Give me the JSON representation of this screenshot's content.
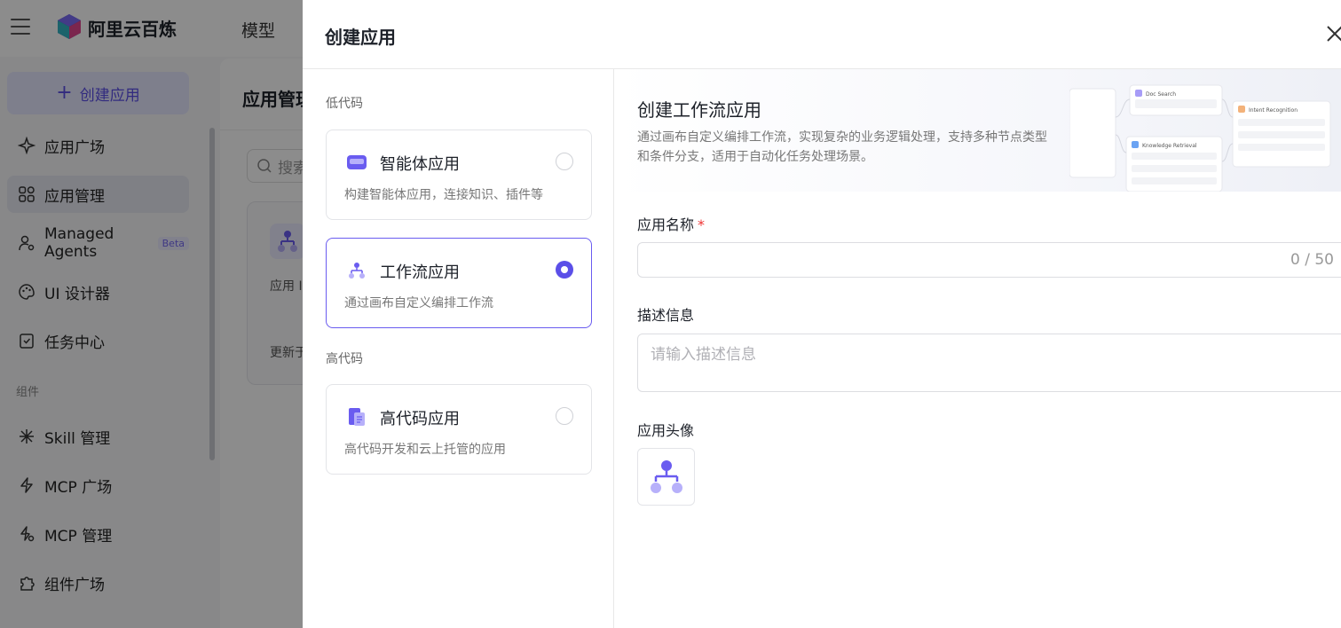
{
  "app": {
    "brand": "阿里云百炼",
    "top_nav_item": "模型",
    "create_button": "创建应用",
    "sidebar": {
      "items": [
        {
          "label": "应用广场",
          "icon": "sparkle-icon"
        },
        {
          "label": "应用管理",
          "icon": "grid-icon",
          "active": true
        },
        {
          "label": "Managed Agents",
          "icon": "user-gear-icon",
          "badge": "Beta"
        },
        {
          "label": "UI 设计器",
          "icon": "palette-icon"
        },
        {
          "label": "任务中心",
          "icon": "task-icon"
        }
      ],
      "group_label": "组件",
      "group_items": [
        {
          "label": "Skill 管理",
          "icon": "skill-icon"
        },
        {
          "label": "MCP 广场",
          "icon": "bolt-icon"
        },
        {
          "label": "MCP 管理",
          "icon": "bolt-gear-icon"
        },
        {
          "label": "组件广场",
          "icon": "puzzle-icon"
        }
      ]
    },
    "main": {
      "title": "应用管理",
      "search_placeholder": "搜索",
      "card_line1": "应用 I",
      "card_line2": "更新于"
    }
  },
  "drawer": {
    "title": "创建应用",
    "low_code_label": "低代码",
    "high_code_label": "高代码",
    "types": [
      {
        "title": "智能体应用",
        "desc": "构建智能体应用，连接知识、插件等",
        "selected": false
      },
      {
        "title": "工作流应用",
        "desc": "通过画布自定义编排工作流",
        "selected": true
      },
      {
        "title": "高代码应用",
        "desc": "高代码开发和云上托管的应用",
        "selected": false
      }
    ],
    "banner": {
      "title": "创建工作流应用",
      "desc": "通过画布自定义编排工作流，实现复杂的业务逻辑处理，支持多种节点类型和条件分支，适用于自动化任务处理场景。",
      "art_labels": {
        "doc_search": "Doc Search",
        "intent": "Intent Recognition",
        "knowledge": "Knowledge Retrieval"
      }
    },
    "form": {
      "name_label": "应用名称",
      "required_mark": "*",
      "name_counter": "0 / 50",
      "desc_label": "描述信息",
      "desc_placeholder": "请输入描述信息",
      "avatar_label": "应用头像"
    },
    "accent_color": "#5b4fe8"
  }
}
